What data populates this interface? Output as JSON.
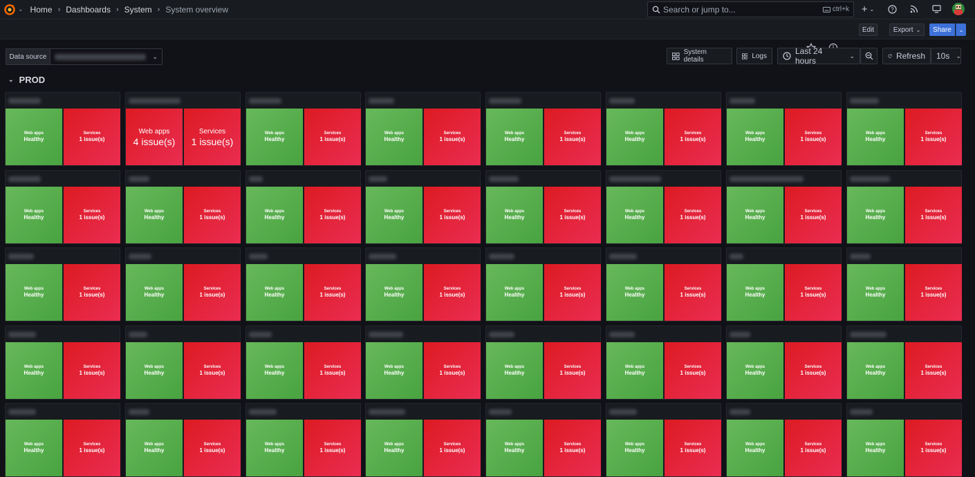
{
  "topbar": {
    "breadcrumbs": [
      "Home",
      "Dashboards",
      "System",
      "System overview"
    ],
    "search_placeholder": "Search or jump to...",
    "search_shortcut": "ctrl+k",
    "plus_label": "+"
  },
  "actionbar": {
    "edit_label": "Edit",
    "export_label": "Export",
    "share_label": "Share"
  },
  "controls": {
    "datasource_label": "Data source",
    "system_details_label": "System details",
    "logs_label": "Logs",
    "time_range": "Last 24 hours",
    "refresh_label": "Refresh",
    "refresh_interval": "10s"
  },
  "row": {
    "title": "PROD"
  },
  "tile_text": {
    "web_label": "Web apps",
    "svc_label": "Services",
    "healthy_value": "Healthy",
    "issue_value": "1 issue(s)"
  },
  "special_tile": {
    "web_value": "4 issue(s)",
    "svc_value": "1 issue(s)"
  },
  "grid": {
    "rows": 5,
    "cols": 8,
    "special_index": 1,
    "title_fill": [
      [
        0.28,
        0.45,
        0.28,
        0.22,
        0.28,
        0.22,
        0.22,
        0.25
      ],
      [
        0.28,
        0.18,
        0.12,
        0.16,
        0.26,
        0.45,
        0.64,
        0.35
      ],
      [
        0.22,
        0.2,
        0.16,
        0.24,
        0.22,
        0.24,
        0.12,
        0.18
      ],
      [
        0.24,
        0.16,
        0.2,
        0.3,
        0.22,
        0.22,
        0.18,
        0.32
      ],
      [
        0.24,
        0.18,
        0.24,
        0.32,
        0.2,
        0.24,
        0.18,
        0.2
      ]
    ]
  },
  "colors": {
    "healthy": "#55ab49",
    "issue": "#e2223b",
    "primary": "#3d71d9",
    "background": "#111217"
  },
  "icons": [
    "grafana-logo-icon",
    "search-icon",
    "plus-icon",
    "help-icon",
    "rss-icon",
    "monitor-icon",
    "star-icon",
    "info-icon",
    "grid-icon",
    "clock-icon",
    "zoom-out-icon",
    "refresh-icon"
  ]
}
